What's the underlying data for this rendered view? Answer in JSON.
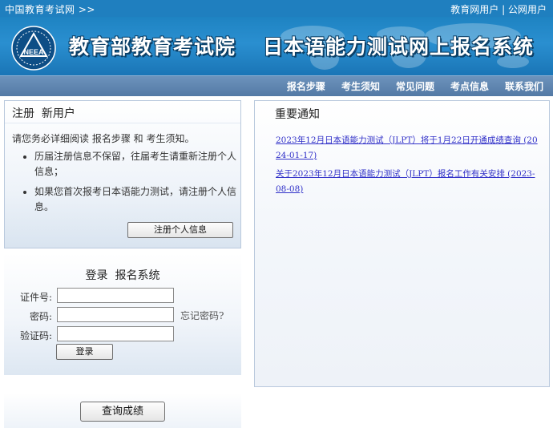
{
  "topbar": {
    "site_link": "中国教育考试网 >>",
    "edu_user": "教育网用户",
    "separator": "|",
    "public_user": "公网用户"
  },
  "banner": {
    "logo_text": "NEEA",
    "title_org": "教育部教育考试院",
    "title_system": "日本语能力测试网上报名系统"
  },
  "nav": {
    "items": [
      "报名步骤",
      "考生须知",
      "常见问题",
      "考点信息",
      "联系我们"
    ]
  },
  "register": {
    "title": "注册  新用户",
    "intro": "请您务必详细阅读 报名步骤 和 考生须知。",
    "bullets": [
      "历届注册信息不保留，往届考生请重新注册个人信息；",
      "如果您首次报考日本语能力测试，请注册个人信息。"
    ],
    "button_label": "注册个人信息"
  },
  "login": {
    "title": "登录  报名系统",
    "id_label": "证件号:",
    "password_label": "密码:",
    "captcha_label": "验证码:",
    "id_value": "",
    "password_value": "",
    "captcha_value": "",
    "forgot_label": "忘记密码?",
    "button_label": "登录"
  },
  "query": {
    "button_label": "查询成绩"
  },
  "notice": {
    "title": "重要通知",
    "items": [
      "2023年12月日本语能力测试（JLPT）将于1月22日开通成绩查询 (2024-01-17)",
      "关于2023年12月日本语能力测试（JLPT）报名工作有关安排 (2023-08-08)"
    ]
  },
  "colors": {
    "topbar": "#1f7fbf",
    "banner": "#1e83c2",
    "navbar": "#5b82ad",
    "link": "#3030c8"
  }
}
